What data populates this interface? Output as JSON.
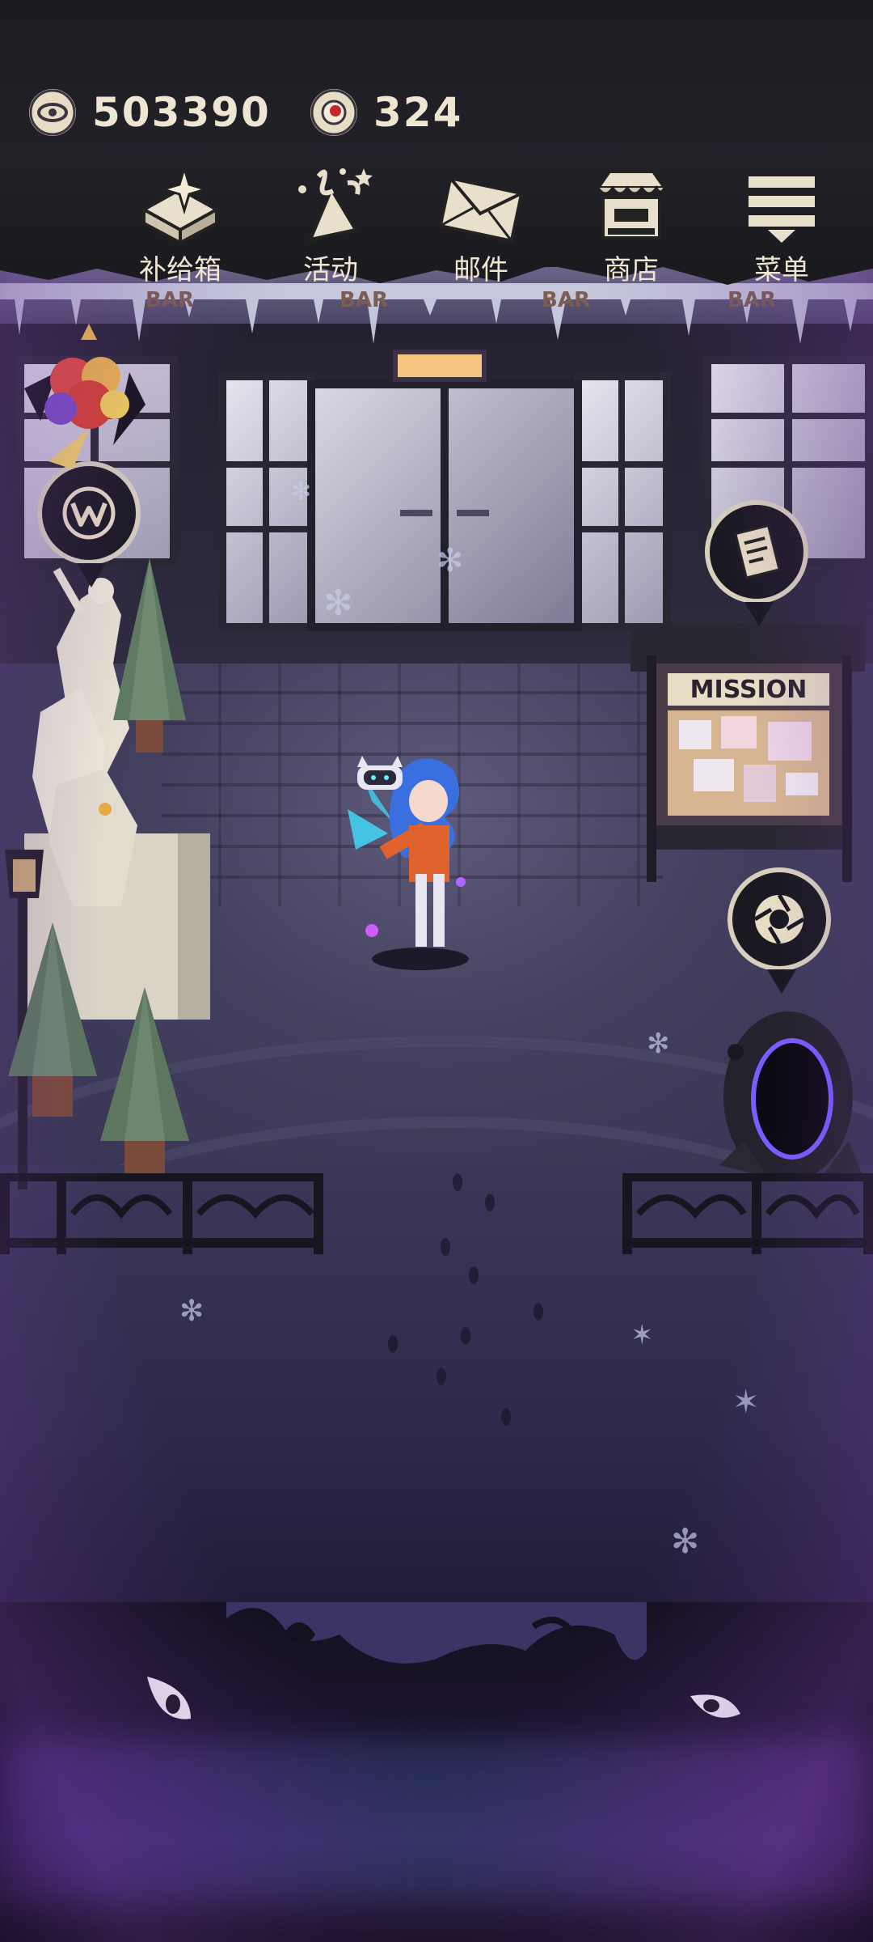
{
  "currencies": {
    "coins": {
      "icon": "eye-coin-icon",
      "amount": "503390"
    },
    "gems": {
      "icon": "red-eye-token-icon",
      "amount": "324"
    }
  },
  "nav": [
    {
      "id": "supply",
      "label": "补给箱",
      "icon": "supply-box-icon"
    },
    {
      "id": "events",
      "label": "活动",
      "icon": "party-popper-icon"
    },
    {
      "id": "mail",
      "label": "邮件",
      "icon": "mail-icon"
    },
    {
      "id": "shop",
      "label": "商店",
      "icon": "shop-icon"
    },
    {
      "id": "menu",
      "label": "菜单",
      "icon": "menu-icon"
    }
  ],
  "scene": {
    "bar_signs": [
      "BAR",
      "BAR",
      "BAR",
      "BAR"
    ],
    "mission_board_title": "MISSION"
  },
  "colors": {
    "hud_bg": "#1d1c22",
    "hud_text": "#efe6d2",
    "lamp": "#f6c681",
    "hero_hair": "#3a6fe0",
    "hero_suit": "#e0622c",
    "portal_glow": "#7a5cff"
  }
}
